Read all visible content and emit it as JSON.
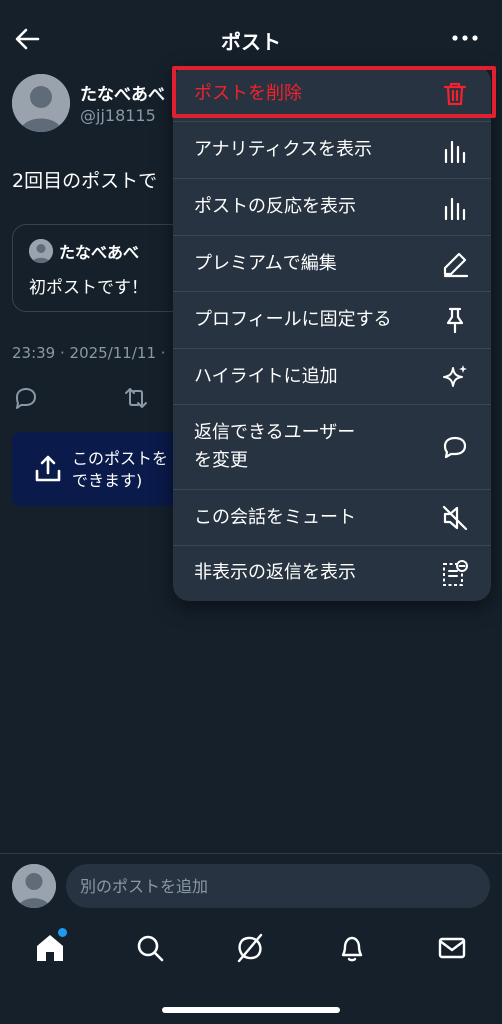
{
  "header": {
    "title": "ポスト",
    "back_icon": "arrow-left-icon",
    "more_icon": "more-horizontal-icon"
  },
  "post": {
    "author_name": "たなべあべ",
    "author_handle": "@jj18115",
    "text": "2回目のポストで",
    "quote": {
      "author_name": "たなべあべ",
      "text": "初ポストです！"
    },
    "timestamp": "23:39 · 2025/11/11 ·",
    "actions": [
      "reply-icon",
      "repost-icon"
    ]
  },
  "share_banner": {
    "text_line1": "このポストを",
    "text_line2": "できます)"
  },
  "menu": {
    "items": [
      {
        "label": "ポストを削除",
        "icon": "trash-icon",
        "danger": true
      },
      {
        "label": "アナリティクスを表示",
        "icon": "analytics-icon"
      },
      {
        "label": "ポストの反応を表示",
        "icon": "analytics-icon"
      },
      {
        "label": "プレミアムで編集",
        "icon": "pencil-icon"
      },
      {
        "label": "プロフィールに固定する",
        "icon": "pin-icon"
      },
      {
        "label": "ハイライトに追加",
        "icon": "sparkle-icon"
      },
      {
        "label": "返信できるユーザーを変更",
        "label_line1": "返信できるユーザー",
        "label_line2": "を変更",
        "icon": "speech-bubble-icon"
      },
      {
        "label": "この会話をミュート",
        "icon": "mute-icon"
      },
      {
        "label": "非表示の返信を表示",
        "icon": "hidden-replies-icon"
      }
    ]
  },
  "composer": {
    "placeholder": "別のポストを追加"
  },
  "nav": {
    "items": [
      "home-icon",
      "search-icon",
      "grok-icon",
      "bell-icon",
      "mail-icon"
    ],
    "home_has_notification": true
  },
  "colors": {
    "background": "#15202b",
    "menu_background": "#273340",
    "danger": "#f4212e",
    "accent": "#1d9bf0",
    "highlight_border": "#e0202e"
  }
}
